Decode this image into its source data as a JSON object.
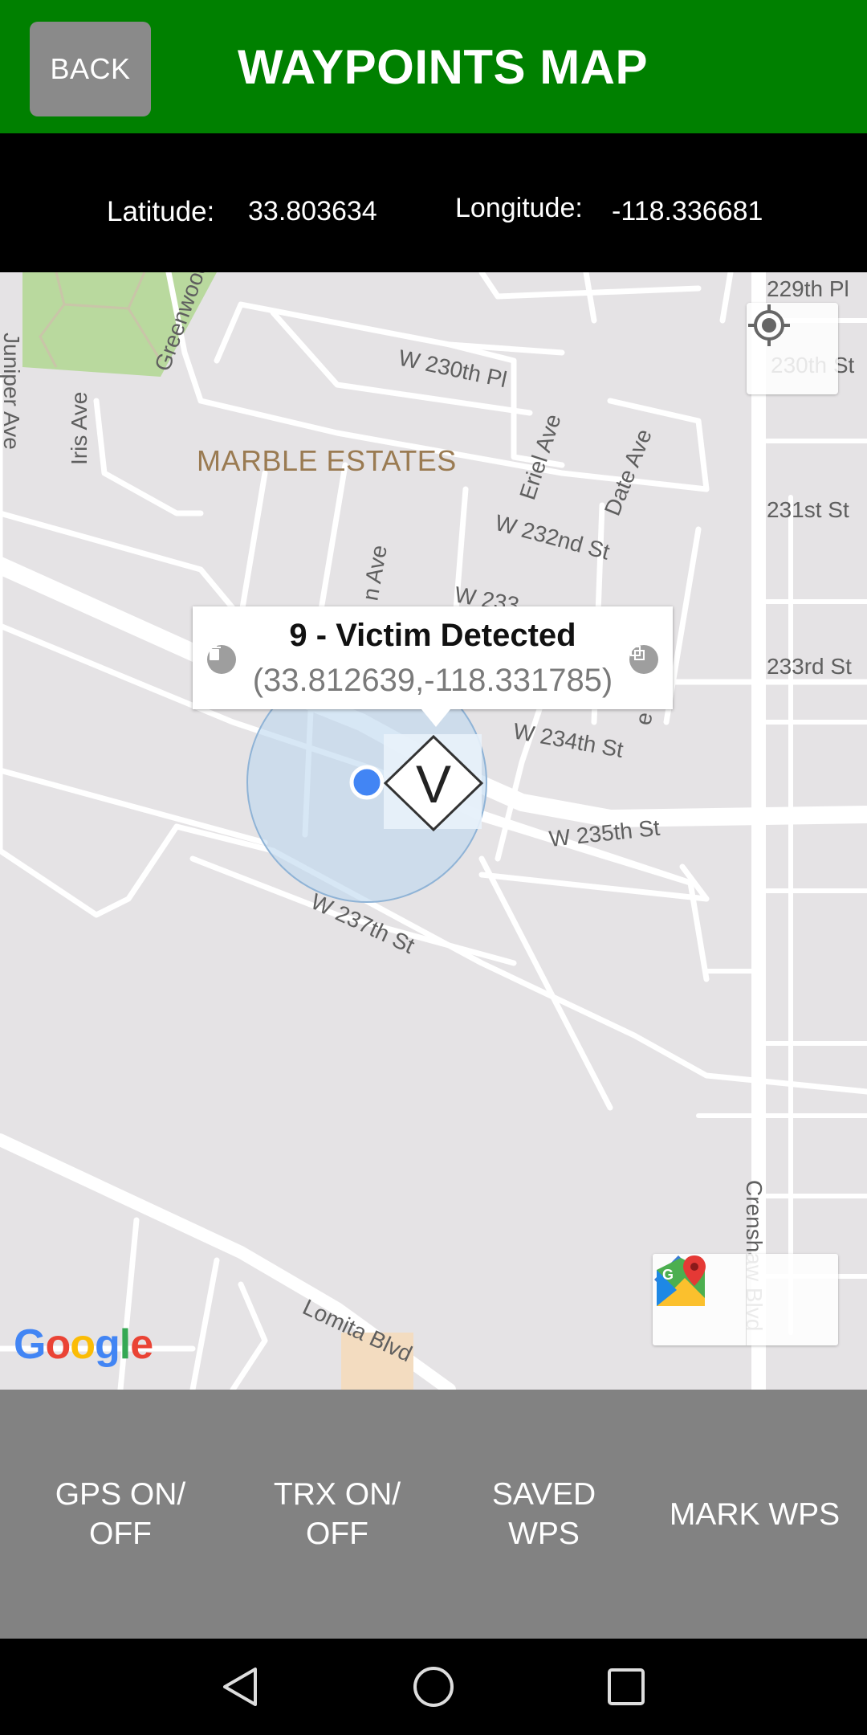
{
  "header": {
    "back_label": "BACK",
    "title": "WAYPOINTS MAP"
  },
  "coords": {
    "lat_label": "Latitude:",
    "lat_value": "33.803634",
    "lon_label": "Longitude:",
    "lon_value": "-118.336681"
  },
  "map": {
    "area_label": "MARBLE ESTATES",
    "streets": [
      "229th Pl",
      "W 230th Pl",
      "230th St",
      "Juniper Ave",
      "Iris Ave",
      "Greenwood",
      "Eriel Ave",
      "Date Ave",
      "W 232nd St",
      "231st St",
      "W 233",
      "233rd St",
      "W 234th St",
      "W 235th St",
      "W 237th St",
      "Lomita Blvd",
      "Crenshaw Blvd",
      "n Ave",
      "e"
    ],
    "marker_letter": "V",
    "infowindow": {
      "title": "9 - Victim Detected",
      "coords": "(33.812639,-118.331785)"
    },
    "google_logo": {
      "G": "G",
      "o1": "o",
      "o2": "o",
      "g": "g",
      "l": "l",
      "e": "e"
    },
    "icons": [
      "my-location-icon",
      "directions-icon",
      "google-maps-icon",
      "delete-icon",
      "copy-icon"
    ],
    "colors": {
      "accent_green": "#008000",
      "my_location_blue": "#4285f4",
      "accuracy_circle": "#bcd7ee"
    }
  },
  "actions": {
    "gps_line1": "GPS ON/",
    "gps_line2": "OFF",
    "trx_line1": "TRX ON/",
    "trx_line2": "OFF",
    "saved_line1": "SAVED",
    "saved_line2": "WPS",
    "mark": "MARK WPS"
  },
  "navbar": {
    "icons": [
      "back-triangle-icon",
      "home-circle-icon",
      "recents-square-icon"
    ]
  }
}
